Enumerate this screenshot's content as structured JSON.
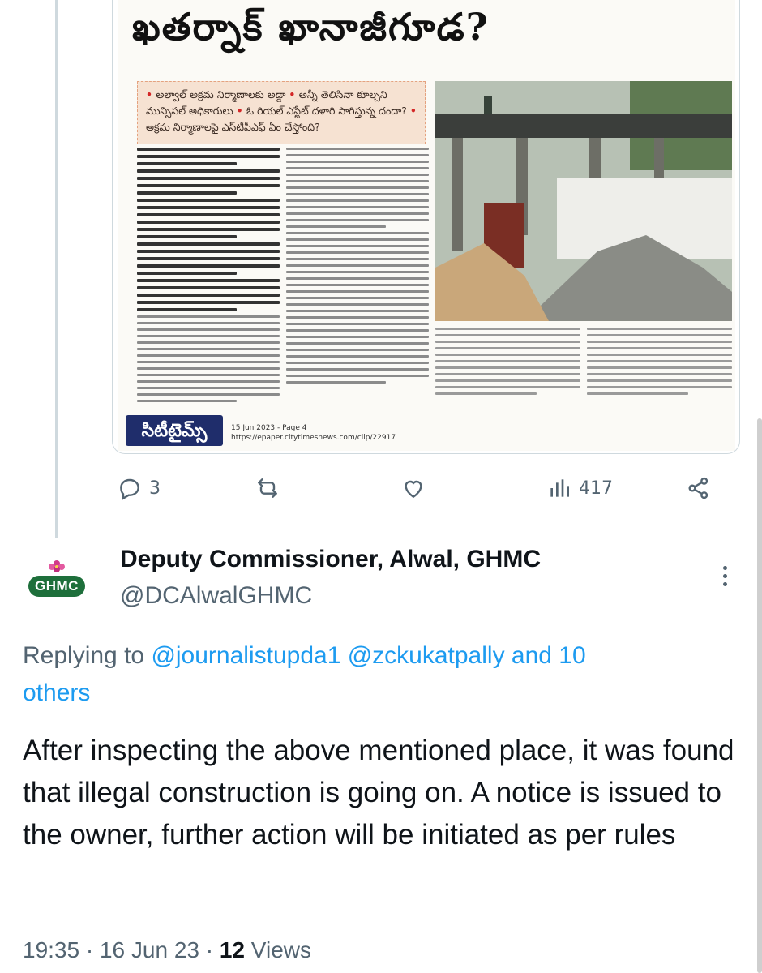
{
  "clip": {
    "headline": "ఖతర్నాక్ ఖానాజీగూడ?",
    "subhead": [
      "అల్వాల్ అక్రమ నిర్మాణాలకు అడ్డా",
      "అన్నీ తెలిసినా కూల్చని మున్సిపల్ అధికారులు",
      "ఓ రియల్ ఎస్టేట్ దళారి సాగిస్తున్న దందా?",
      "అక్రమ నిర్మాణాలపై ఎస్‌టీపీఎఫ్ ఏం చేస్తోంది?"
    ],
    "masthead": "సిటీటైమ్స్",
    "date_page": "15 Jun 2023 - Page 4",
    "url": "https://epaper.citytimesnews.com/clip/22917"
  },
  "actions": {
    "reply_count": "3",
    "repost_count": "",
    "like_count": "",
    "views_count": "417"
  },
  "tweet": {
    "avatar_text": "GHMC",
    "display_name": "Deputy Commissioner, Alwal, GHMC",
    "handle": "@DCAlwalGHMC",
    "replying_prefix": "Replying to ",
    "mention_1": "@journalistupda1",
    "mention_2": "@zckukatpally",
    "replying_suffix_1": " and 10",
    "replying_suffix_2": "others",
    "body": "After inspecting the above mentioned place, it was found that illegal construction is going on.  A notice is issued to the owner, further action will be initiated as per rules",
    "time": "19:35",
    "date": "16 Jun 23",
    "views_num": "12",
    "views_label": "Views",
    "sep": " · "
  },
  "colors": {
    "accent": "#1d9bf0",
    "secondary_text": "#536471",
    "primary_text": "#0f1419",
    "ghmc_green": "#1e6f3b"
  },
  "icons": [
    "reply-icon",
    "repost-icon",
    "like-icon",
    "views-icon",
    "share-icon",
    "more-icon"
  ]
}
